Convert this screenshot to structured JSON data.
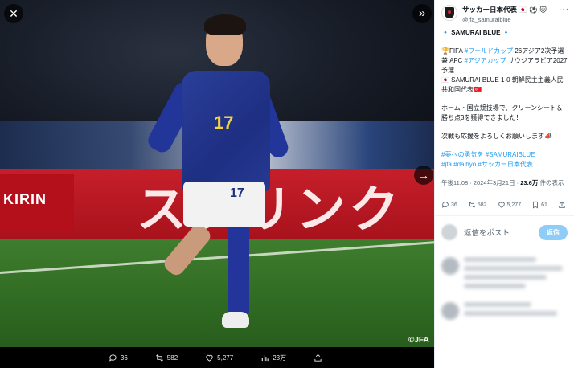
{
  "viewer": {
    "close_icon": "close-icon",
    "expand_icon": "expand-right-icon",
    "next_icon": "arrow-right-icon",
    "photo_credit": "©JFA",
    "ad_board_left": "KIRIN",
    "ad_board_main": "スプリンク",
    "jersey_number": "17",
    "actions": {
      "replies": "36",
      "reposts": "582",
      "likes": "5,277",
      "views": "23万"
    }
  },
  "tweet": {
    "display_name": "サッカー日本代表 🇯🇵 ⚽ 🐱",
    "handle": "@jfa_samuraiblue",
    "team_tag": "🔹 SAMURAI BLUE 🔹",
    "line1_prefix": "🏆FIFA ",
    "line1_tag1": "#ワールドカップ",
    "line1_mid": " 26アジア2次予選 兼 AFC ",
    "line1_tag2": "#アジアカップ",
    "line1_suffix": " サウジアラビア2027予選",
    "line2": "🇯🇵 SAMURAI BLUE 1-0 朝鮮民主主義人民共和国代表🇰🇵",
    "line3": "ホーム・国立競技場で、クリーンシート＆勝ち点3を獲得できました！",
    "line4": "次戦も応援をよろしくお願いします📣",
    "tags_1": "#夢への勇気を",
    "tags_2": "#SAMURAIBLUE",
    "tags_3": "#jfa",
    "tags_4": "#daihyo",
    "tags_5": "#サッカー日本代表",
    "time_text": "午後11:08 · 2024年3月21日 · ",
    "views_count": "23.6万",
    "views_suffix": " 件の表示",
    "stats": {
      "replies": "36",
      "reposts": "582",
      "likes": "5,277",
      "bookmarks": "61"
    },
    "reply_placeholder": "返信をポスト",
    "reply_button": "返信"
  }
}
